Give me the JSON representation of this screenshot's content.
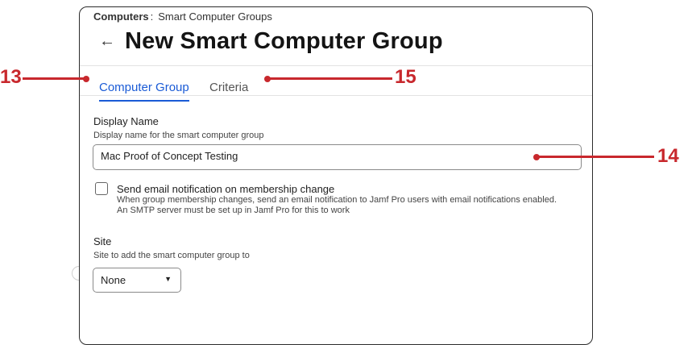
{
  "breadcrumb": {
    "root": "Computers",
    "separator": ":",
    "current": "Smart Computer Groups"
  },
  "header": {
    "back_icon": "←",
    "title": "New Smart Computer Group"
  },
  "tabs": [
    {
      "label": "Computer Group",
      "active": true
    },
    {
      "label": "Criteria",
      "active": false
    }
  ],
  "display_name": {
    "label": "Display Name",
    "help": "Display name for the smart computer group",
    "value": "Mac Proof of Concept Testing"
  },
  "email_notification": {
    "label": "Send email notification on membership change",
    "description": "When group membership changes, send an email notification to Jamf Pro users with email notifications enabled. An SMTP server must be set up in Jamf Pro for this to work",
    "checked": false
  },
  "site": {
    "label": "Site",
    "help": "Site to add the smart computer group to",
    "selected": "None",
    "caret": "▼"
  },
  "callouts": {
    "tabs_left": "13",
    "tabs_right": "15",
    "display_name": "14"
  },
  "colors": {
    "accent": "#1a5bd6",
    "callout": "#c8282d"
  }
}
